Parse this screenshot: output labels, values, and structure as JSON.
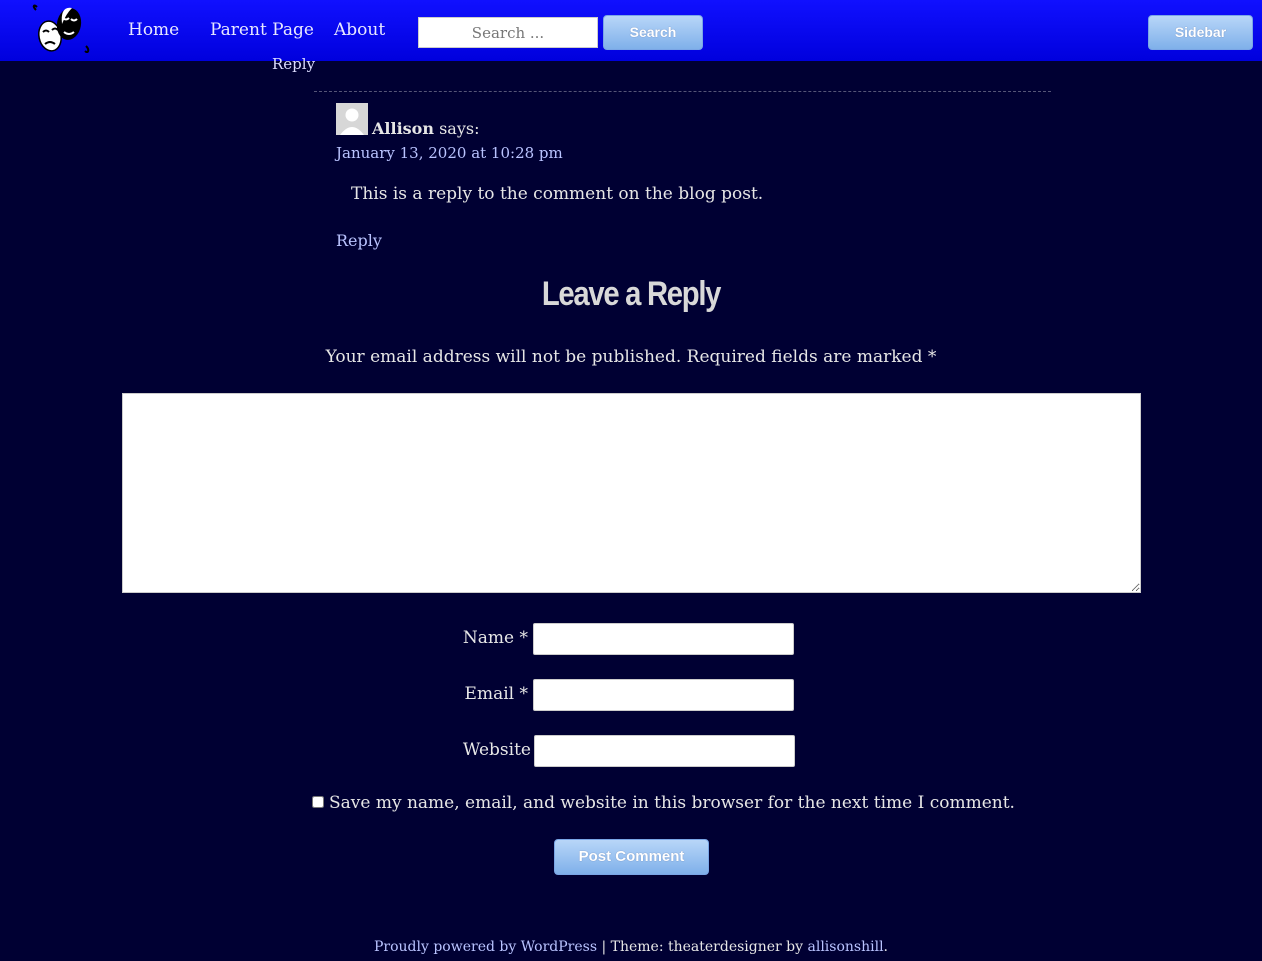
{
  "header": {
    "nav": [
      "Home",
      "Parent Page",
      "About"
    ],
    "search_placeholder": "Search ...",
    "search_button": "Search",
    "sidebar_button": "Sidebar"
  },
  "comments": {
    "top_reply": "Reply",
    "reply": {
      "author": "Allison",
      "says": "says:",
      "date": "January 13, 2020 at 10:28 pm",
      "text": "This is a reply to the comment on the blog post.",
      "reply_label": "Reply"
    }
  },
  "form": {
    "title": "Leave a Reply",
    "notes": "Your email address will not be published. Required fields are marked *",
    "name_label": "Name *",
    "email_label": "Email *",
    "website_label": "Website",
    "cookies_label": "Save my name, email, and website in this browser for the next time I comment.",
    "submit": "Post Comment"
  },
  "footer": {
    "powered": "Proudly powered by WordPress",
    "separator": " | Theme: theaterdesigner by ",
    "author_link": "allisonshill",
    "end": "."
  },
  "colors": {
    "header_bg": "#0000ee",
    "page_bg": "#000033",
    "link": "#b9c3ff",
    "button": "#8fbcf0"
  }
}
